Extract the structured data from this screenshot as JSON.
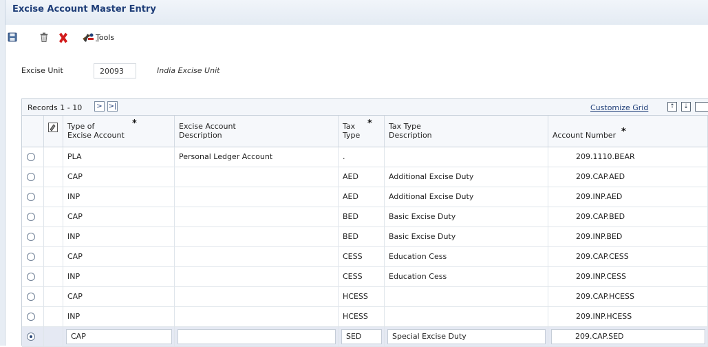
{
  "header": {
    "title": "Excise Account Master Entry"
  },
  "toolbar": {
    "save_icon": "floppy-disk-icon",
    "delete_icon": "trash-icon",
    "cancel_icon": "red-x-icon",
    "tools_icon": "tools-icon",
    "tools_label_first": "T",
    "tools_label_rest": "ools"
  },
  "form": {
    "excise_unit_label": "Excise Unit",
    "excise_unit_value": "20093",
    "excise_unit_description": "India Excise Unit"
  },
  "grid": {
    "records_label": "Records 1 - 10",
    "next_glyph": ">",
    "last_glyph": ">|",
    "customize_label": "Customize Grid",
    "columns": [
      {
        "line1": "Type of",
        "line2": "Excise Account",
        "required": "*"
      },
      {
        "line1": "Excise Account",
        "line2": "Description",
        "required": ""
      },
      {
        "line1": "Tax",
        "line2": "Type",
        "required": "*"
      },
      {
        "line1": "Tax Type",
        "line2": "Description",
        "required": ""
      },
      {
        "line1": "",
        "line2": "Account Number",
        "required": "*"
      }
    ],
    "rows": [
      {
        "type": "PLA",
        "desc": "Personal Ledger Account",
        "tax": ".",
        "tax_desc": "",
        "account": "209.1110.BEAR"
      },
      {
        "type": "CAP",
        "desc": "",
        "tax": "AED",
        "tax_desc": "Additional Excise Duty",
        "account": "209.CAP.AED"
      },
      {
        "type": "INP",
        "desc": "",
        "tax": "AED",
        "tax_desc": "Additional Excise Duty",
        "account": "209.INP.AED"
      },
      {
        "type": "CAP",
        "desc": "",
        "tax": "BED",
        "tax_desc": "Basic Excise Duty",
        "account": "209.CAP.BED"
      },
      {
        "type": "INP",
        "desc": "",
        "tax": "BED",
        "tax_desc": "Basic Excise Duty",
        "account": "209.INP.BED"
      },
      {
        "type": "CAP",
        "desc": "",
        "tax": "CESS",
        "tax_desc": "Education Cess",
        "account": "209.CAP.CESS"
      },
      {
        "type": "INP",
        "desc": "",
        "tax": "CESS",
        "tax_desc": "Education Cess",
        "account": "209.INP.CESS"
      },
      {
        "type": "CAP",
        "desc": "",
        "tax": "HCESS",
        "tax_desc": "",
        "account": "209.CAP.HCESS"
      },
      {
        "type": "INP",
        "desc": "",
        "tax": "HCESS",
        "tax_desc": "",
        "account": "209.INP.HCESS"
      },
      {
        "type": "CAP",
        "desc": "",
        "tax": "SED",
        "tax_desc": "Special Excise Duty",
        "account": "209.CAP.SED"
      }
    ]
  }
}
